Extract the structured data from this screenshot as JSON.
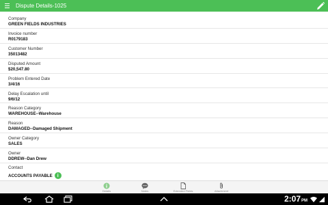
{
  "appbar": {
    "title": "Dispute Details-1025",
    "background": "#4cbf56"
  },
  "fields": [
    {
      "label": "Company",
      "value": "GREEN FIELDS INDUSTRIES"
    },
    {
      "label": "Invoice number",
      "value": "R0179183"
    },
    {
      "label": "Customer Number",
      "value": "35013482"
    },
    {
      "label": "Disputed Amount",
      "value": "$20,547.80"
    },
    {
      "label": "Problem Entered Date",
      "value": "3/4/16"
    },
    {
      "label": "Delay Escalation until",
      "value": "9/6/12"
    },
    {
      "label": "Reason Category",
      "value": "WAREHOUSE--Warehouse"
    },
    {
      "label": "Reason",
      "value": "DAMAGED--Damaged Shipment"
    },
    {
      "label": "Owner Category",
      "value": "SALES"
    },
    {
      "label": "Owner",
      "value": "DDREW--Dan Drew"
    },
    {
      "label": "Contact",
      "value": "ACCOUNTS PAYABLE"
    }
  ],
  "tabs": [
    {
      "label": "Details",
      "icon": "info-icon",
      "active": true
    },
    {
      "label": "Notes",
      "icon": "chat-icon",
      "active": false
    },
    {
      "label": "Extended Fields",
      "icon": "document-icon",
      "active": false
    },
    {
      "label": "Attachment",
      "icon": "paperclip-icon",
      "active": false
    }
  ],
  "system": {
    "clock": "2:07",
    "clock_suffix": "PM"
  },
  "colors": {
    "accent": "#4cbf56",
    "nav_background": "#000000"
  }
}
